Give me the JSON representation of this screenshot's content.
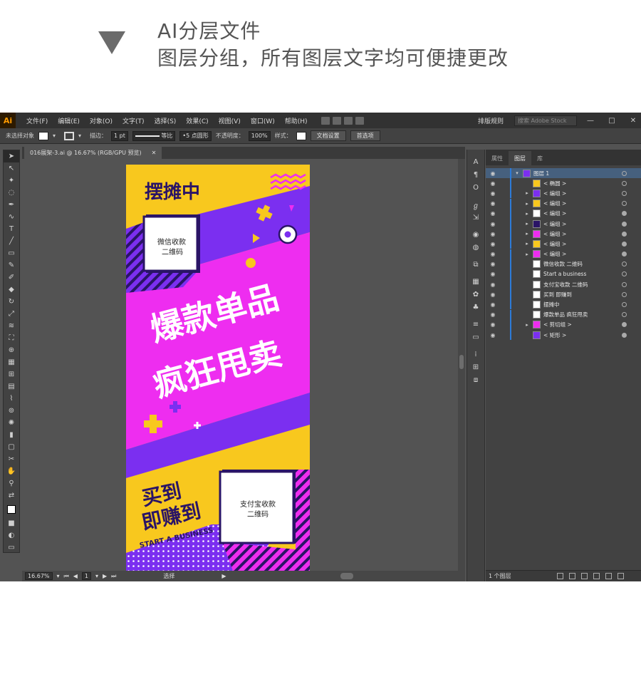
{
  "caption": {
    "line1": "AI分层文件",
    "line2": "图层分组，所有图层文字均可便捷更改"
  },
  "app": {
    "logo": "Ai",
    "menu": [
      "文件(F)",
      "编辑(E)",
      "对象(O)",
      "文字(T)",
      "选择(S)",
      "效果(C)",
      "视图(V)",
      "窗口(W)",
      "帮助(H)"
    ],
    "layout_label": "排版规则",
    "search_placeholder": "搜索 Adobe Stock",
    "win_min": "—",
    "win_max": "□",
    "win_close": "✕"
  },
  "control": {
    "no_selection": "未选择对象",
    "stroke_label": "描边：",
    "stroke_value": "1 pt",
    "stroke_style": "等比",
    "brush": "5 点圆形",
    "opacity_label": "不透明度：",
    "opacity_value": "100%",
    "style_label": "样式：",
    "doc_setup": "文档设置",
    "prefs": "首选项"
  },
  "document": {
    "tab_title": "016展架-3.ai @ 16.67% (RGB/GPU 预览)",
    "tab_close": "✕",
    "zoom": "16.67%",
    "page": "1",
    "status": "选择"
  },
  "artwork": {
    "top_title": "摆摊中",
    "qr_wechat_line1": "微信收款",
    "qr_wechat_line2": "二维码",
    "main_line1": "爆款单品",
    "main_line2": "疯狂甩卖",
    "buy_line1": "买到",
    "buy_line2": "即赚到",
    "english": "START A BUSINESS",
    "qr_alipay_line1": "支付宝收款",
    "qr_alipay_line2": "二维码",
    "colors": {
      "yellow": "#f8c81e",
      "purple": "#7b2ff0",
      "magenta": "#ee2df0",
      "navy": "#2a1466"
    }
  },
  "layers": {
    "tabs": [
      "属性",
      "图层",
      "库"
    ],
    "rows": [
      {
        "name": "图层 1",
        "level": 0,
        "expand": "open",
        "selected": true
      },
      {
        "name": "< 椭圆 >",
        "level": 1,
        "expand": ""
      },
      {
        "name": "< 编组 >",
        "level": 1,
        "expand": "closed"
      },
      {
        "name": "< 编组 >",
        "level": 1,
        "expand": "closed"
      },
      {
        "name": "< 编组 >",
        "level": 1,
        "expand": "closed"
      },
      {
        "name": "< 编组 >",
        "level": 1,
        "expand": "closed"
      },
      {
        "name": "< 编组 >",
        "level": 1,
        "expand": "closed"
      },
      {
        "name": "< 编组 >",
        "level": 1,
        "expand": "closed"
      },
      {
        "name": "< 编组 >",
        "level": 1,
        "expand": "closed"
      },
      {
        "name": "微信收款 二维码",
        "level": 1,
        "expand": ""
      },
      {
        "name": "Start a business",
        "level": 1,
        "expand": ""
      },
      {
        "name": "支付宝收款 二维码",
        "level": 1,
        "expand": ""
      },
      {
        "name": "买到 即赚到",
        "level": 1,
        "expand": ""
      },
      {
        "name": "摆摊中",
        "level": 1,
        "expand": ""
      },
      {
        "name": "爆款单品 疯狂甩卖",
        "level": 1,
        "expand": ""
      },
      {
        "name": "< 剪切组 >",
        "level": 1,
        "expand": "closed"
      },
      {
        "name": "< 矩形 >",
        "level": 1,
        "expand": ""
      }
    ],
    "footer": "1 个图层"
  }
}
